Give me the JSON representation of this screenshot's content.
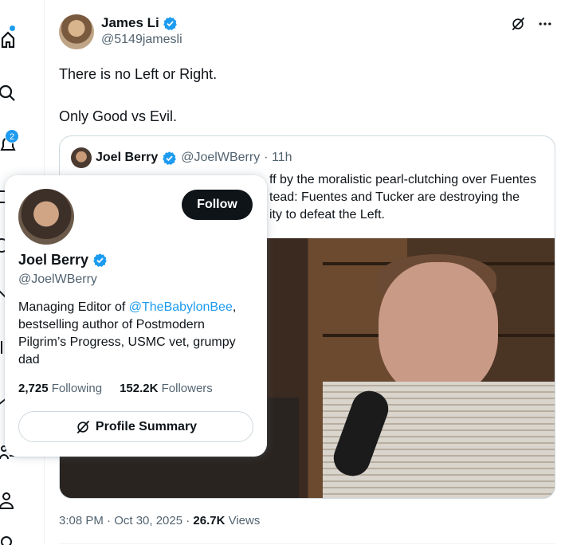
{
  "nav": {
    "notifications_count": "2"
  },
  "tweet": {
    "author_name": "James Li",
    "author_handle": "@5149jamesli",
    "text_lines": [
      "There is no Left or Right.",
      "Only Good vs Evil."
    ],
    "timestamp": "3:08 PM · Oct 30, 2025 · ",
    "views_count": "26.7K",
    "views_label": " Views"
  },
  "quote": {
    "name": "Joel Berry",
    "handle": "@JoelWBerry",
    "time": "· 11h",
    "text_line1": "ff by the moralistic pearl-clutching over Fuentes",
    "text_line2": "tead: Fuentes and Tucker are destroying the",
    "text_line3": "ity to defeat the Left."
  },
  "hovercard": {
    "follow_label": "Follow",
    "name": "Joel Berry",
    "handle": "@JoelWBerry",
    "bio_prefix": "Managing Editor of ",
    "bio_link": "@TheBabylonBee",
    "bio_suffix": ", bestselling author of Postmodern Pilgrim’s Progress, USMC vet, grumpy dad",
    "following_count": "2,725",
    "following_label": " Following",
    "followers_count": "152.2K",
    "followers_label": " Followers",
    "summary_label": "Profile Summary"
  },
  "colors": {
    "accent": "#1d9bf0",
    "text": "#0f1419",
    "secondary": "#536471",
    "border": "#cfd9de"
  },
  "icons": [
    "home-icon",
    "search-icon",
    "bell-icon",
    "grok-icon",
    "more-icon",
    "verified-icon",
    "person-icon"
  ]
}
